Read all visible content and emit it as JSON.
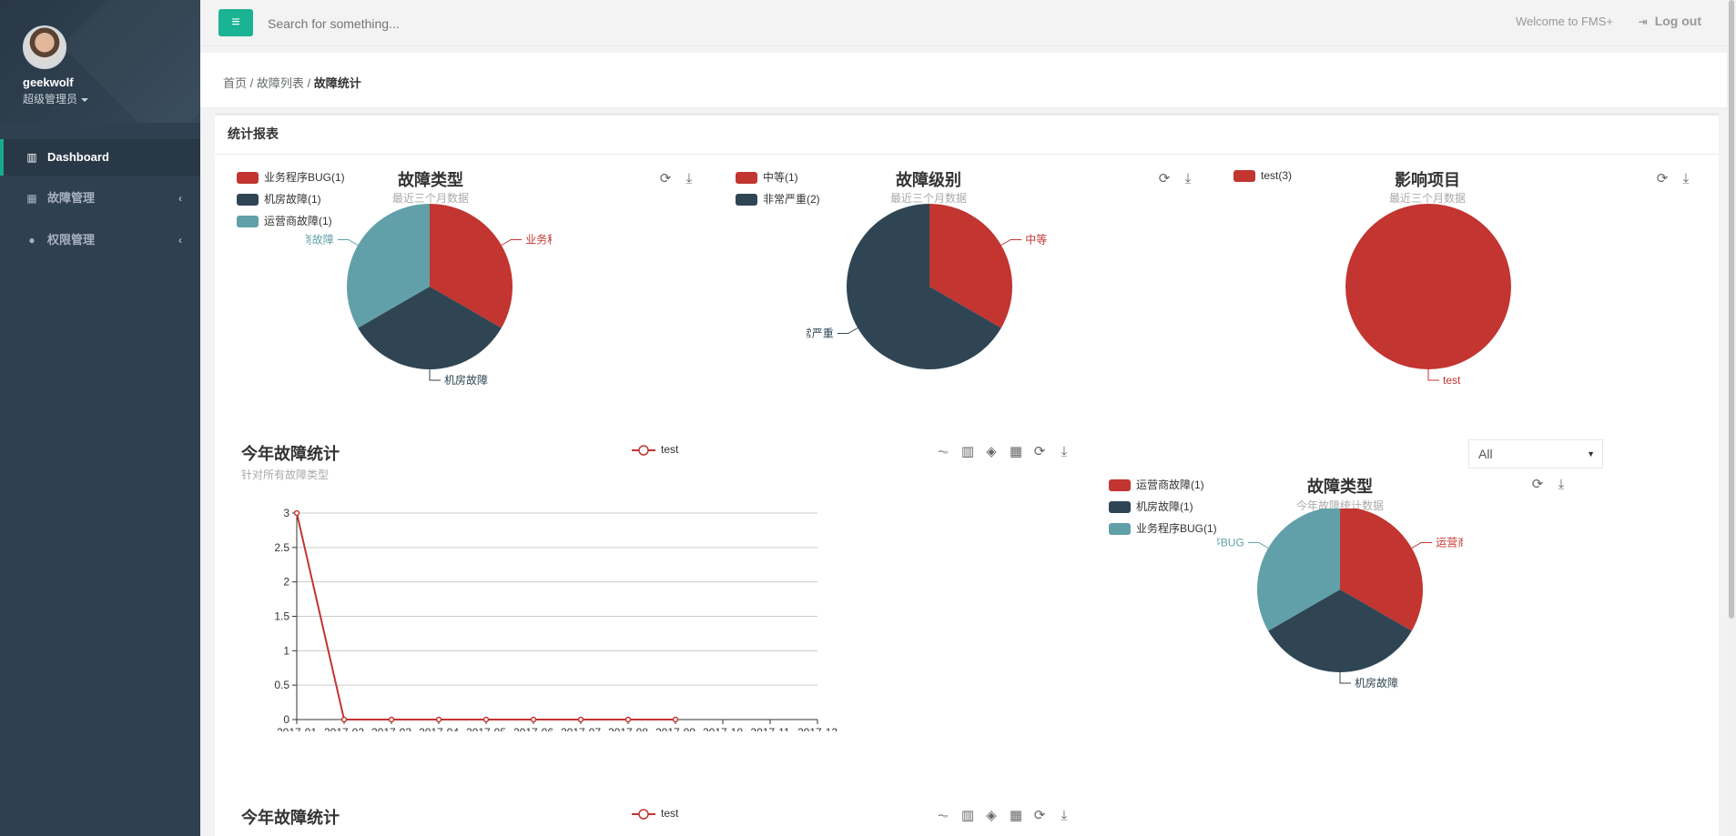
{
  "user": {
    "name": "geekwolf",
    "role": "超级管理员"
  },
  "nav": {
    "items": [
      {
        "label": "Dashboard",
        "icon": "bar-chart-icon",
        "active": true
      },
      {
        "label": "故障管理",
        "icon": "grid-icon"
      },
      {
        "label": "权限管理",
        "icon": "users-icon"
      }
    ]
  },
  "topbar": {
    "menu_icon": "hamburger-icon",
    "search_placeholder": "Search for something...",
    "welcome": "Welcome to FMS+",
    "logout": "Log out"
  },
  "breadcrumb": {
    "home": "首页",
    "sep1": " / ",
    "list": "故障列表",
    "sep2": " / ",
    "current": "故障统计"
  },
  "panel": {
    "title": "统计报表"
  },
  "filter": {
    "selected": "All"
  },
  "colors": {
    "red": "#c23531",
    "navy": "#2f4554",
    "teal": "#61a0a8",
    "accent": "#1ab394"
  },
  "charts": {
    "type_pie": {
      "title": "故障类型",
      "subtitle": "最近三个月数据",
      "legend": [
        "业务程序BUG(1)",
        "机房故障(1)",
        "运营商故障(1)"
      ],
      "labels": [
        "业务程序BUG",
        "机房故障",
        "运营商故障"
      ]
    },
    "level_pie": {
      "title": "故障级别",
      "subtitle": "最近三个月数据",
      "legend": [
        "中等(1)",
        "非常严重(2)"
      ],
      "labels": [
        "中等",
        "非常严重"
      ]
    },
    "project_pie": {
      "title": "影响项目",
      "subtitle": "最近三个月数据",
      "legend": [
        "test(3)"
      ],
      "labels": [
        "test"
      ]
    },
    "year_line": {
      "title": "今年故障统计",
      "subtitle": "针对所有故障类型",
      "legend": "test"
    },
    "year_type_pie": {
      "title": "故障类型",
      "subtitle": "今年故障统计数据",
      "legend": [
        "运营商故障(1)",
        "机房故障(1)",
        "业务程序BUG(1)"
      ],
      "labels": [
        "运营商故障",
        "机房故障",
        "业务程序BUG"
      ]
    },
    "year_line_2": {
      "title": "今年故障统计",
      "legend": "test"
    }
  },
  "chart_data": [
    {
      "type": "pie",
      "title": "故障类型",
      "subtitle": "最近三个月数据",
      "slices": [
        {
          "name": "业务程序BUG",
          "value": 1
        },
        {
          "name": "机房故障",
          "value": 1
        },
        {
          "name": "运营商故障",
          "value": 1
        }
      ]
    },
    {
      "type": "pie",
      "title": "故障级别",
      "subtitle": "最近三个月数据",
      "slices": [
        {
          "name": "中等",
          "value": 1
        },
        {
          "name": "非常严重",
          "value": 2
        }
      ]
    },
    {
      "type": "pie",
      "title": "影响项目",
      "subtitle": "最近三个月数据",
      "slices": [
        {
          "name": "test",
          "value": 3
        }
      ]
    },
    {
      "type": "line",
      "title": "今年故障统计",
      "subtitle": "针对所有故障类型",
      "categories": [
        "2017-01",
        "2017-02",
        "2017-03",
        "2017-04",
        "2017-05",
        "2017-06",
        "2017-07",
        "2017-08",
        "2017-09",
        "2017-10",
        "2017-11",
        "2017-12"
      ],
      "series": [
        {
          "name": "test",
          "values": [
            3,
            0,
            0,
            0,
            0,
            0,
            0,
            0,
            0
          ]
        }
      ],
      "ylim": [
        0,
        3
      ],
      "yticks": [
        "0",
        "0.5",
        "1",
        "1.5",
        "2",
        "2.5",
        "3"
      ],
      "grid": true,
      "legend": "top-center"
    },
    {
      "type": "pie",
      "title": "故障类型",
      "subtitle": "今年故障统计数据",
      "slices": [
        {
          "name": "运营商故障",
          "value": 1
        },
        {
          "name": "机房故障",
          "value": 1
        },
        {
          "name": "业务程序BUG",
          "value": 1
        }
      ]
    }
  ]
}
